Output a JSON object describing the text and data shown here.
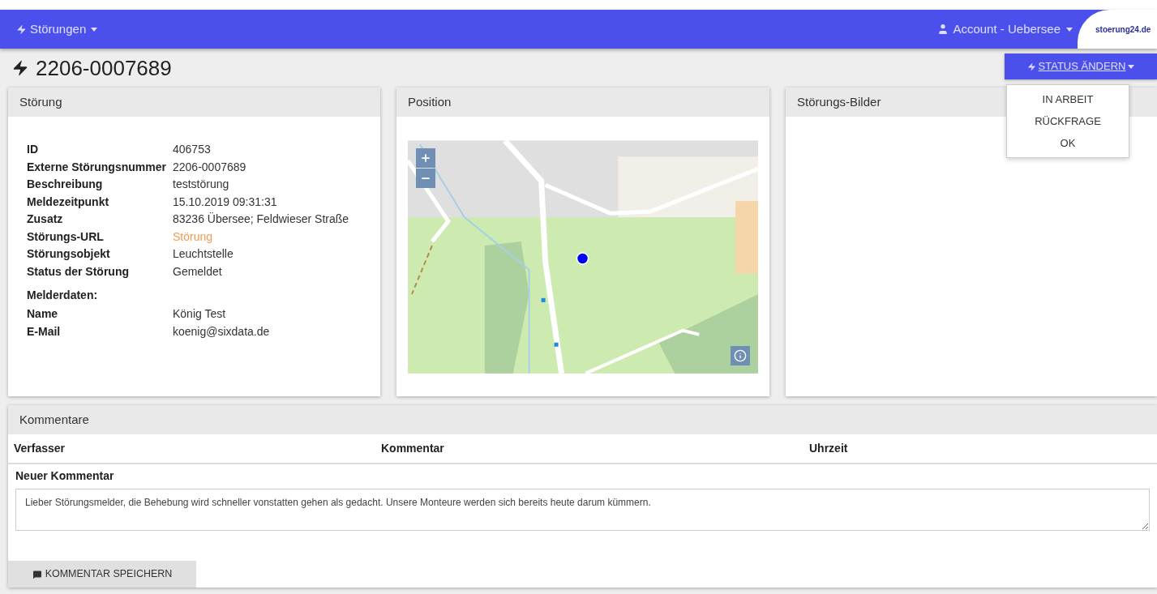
{
  "navbar": {
    "menu": "Störungen",
    "account": "Account - Uebersee",
    "logo": "stoerung24.de"
  },
  "title": "2206-0007689",
  "status_button": {
    "label": "STATUS ÄNDERN",
    "options": [
      "IN ARBEIT",
      "RÜCKFRAGE",
      "OK"
    ]
  },
  "details": {
    "title": "Störung",
    "fields": [
      {
        "label": "ID",
        "value": "406753",
        "kind": "text"
      },
      {
        "label": "Externe Störungsnummer",
        "value": "2206-0007689",
        "kind": "text"
      },
      {
        "label": "Beschreibung",
        "value": "teststörung",
        "kind": "text"
      },
      {
        "label": "Meldezeitpunkt",
        "value": "15.10.2019 09:31:31",
        "kind": "text"
      },
      {
        "label": "Zusatz",
        "value": "83236 Übersee; Feldwieser Straße",
        "kind": "text"
      },
      {
        "label": "Störungs-URL",
        "value": "Störung",
        "kind": "link"
      },
      {
        "label": "Störungsobjekt",
        "value": "Leuchtstelle",
        "kind": "text"
      },
      {
        "label": "Status der Störung",
        "value": "Gemeldet",
        "kind": "text"
      }
    ],
    "reporter_heading": "Melderdaten:",
    "reporter": [
      {
        "label": "Name",
        "value": "König Test"
      },
      {
        "label": "E-Mail",
        "value": "koenig@sixdata.de"
      }
    ]
  },
  "position": {
    "title": "Position"
  },
  "images": {
    "title": "Störungs-Bilder"
  },
  "comments": {
    "title": "Kommentare",
    "columns": [
      "Verfasser",
      "Kommentar",
      "Uhrzeit"
    ],
    "new_label": "Neuer Kommentar",
    "new_value": "Lieber Störungsmelder, die Behebung wird schneller vonstatten gehen als gedacht. Unsere Monteure werden sich bereits heute darum kümmern.",
    "save": "KOMMENTAR SPEICHERN"
  }
}
